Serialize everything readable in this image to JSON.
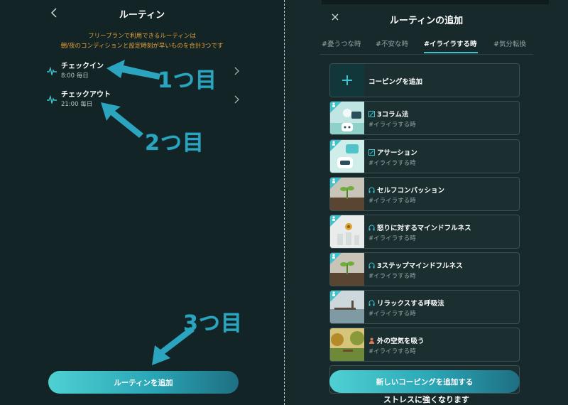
{
  "left": {
    "title": "ルーティン",
    "notice_line1": "フリープランで利用できるルーティンは",
    "notice_line2": "朝/夜のコンディションと設定時刻が早いものを合計3つです",
    "routines": [
      {
        "name": "チェックイン",
        "time": "8:00 毎日"
      },
      {
        "name": "チェックアウト",
        "time": "21:00 毎日"
      }
    ],
    "annotations": [
      "1つ目",
      "2つ目",
      "3つ目"
    ],
    "add_button": "ルーティンを追加"
  },
  "right": {
    "title": "ルーティンの追加",
    "tabs": [
      "#憂うつな時",
      "#不安な時",
      "#イライラする時",
      "#気分転換"
    ],
    "active_tab": 2,
    "add_coping": "コーピングを追加",
    "items": [
      {
        "title": "3コラム法",
        "tag": "#イライラする時",
        "icon": "pencil-icon",
        "thumb": "robot-chat-illustration"
      },
      {
        "title": "アサーション",
        "tag": "#イライラする時",
        "icon": "pencil-icon",
        "thumb": "robot-speech-illustration"
      },
      {
        "title": "セルフコンパッション",
        "tag": "#イライラする時",
        "icon": "headphones-icon",
        "thumb": "sprout-soil-photo"
      },
      {
        "title": "怒りに対するマインドフルネス",
        "tag": "#イライラする時",
        "icon": "headphones-icon",
        "thumb": "flowers-vases-photo"
      },
      {
        "title": "3ステップマインドフルネス",
        "tag": "#イライラする時",
        "icon": "headphones-icon",
        "thumb": "sprout-soil-photo"
      },
      {
        "title": "リラックスする呼吸法",
        "tag": "#イライラする時",
        "icon": "headphones-icon",
        "thumb": "lake-pier-photo"
      },
      {
        "title": "外の空気を吸う",
        "tag": "#イライラする時",
        "icon": "person-icon",
        "thumb": "park-bench-photo"
      }
    ],
    "add_new_button": "新しいコーピングを追加する",
    "bottom_caption": "ストレスに強くなります"
  },
  "colors": {
    "accent": "#3fc2cc",
    "annotation": "#2aa4bf",
    "notice": "#e3a03a",
    "background": "#122426"
  }
}
